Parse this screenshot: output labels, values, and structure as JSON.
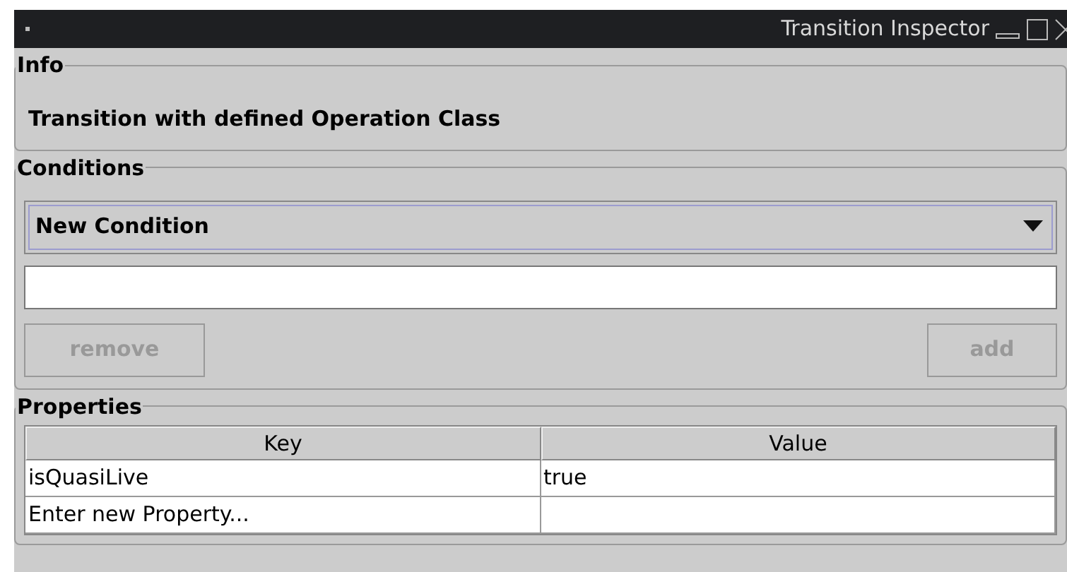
{
  "window": {
    "title": "Transition Inspector"
  },
  "info": {
    "heading": "Info",
    "text": "Transition with defined Operation Class"
  },
  "conditions": {
    "heading": "Conditions",
    "dropdown": {
      "value": "New Condition"
    },
    "buttons": [
      {
        "label": "remove",
        "disabled": true
      },
      {
        "label": "add",
        "disabled": true
      }
    ]
  },
  "properties": {
    "heading": "Properties",
    "table": {
      "columns": [
        "Key",
        "Value"
      ],
      "rows": [
        [
          "isQuasiLive",
          "true"
        ],
        [
          "Enter new Property...",
          null
        ]
      ]
    }
  }
}
